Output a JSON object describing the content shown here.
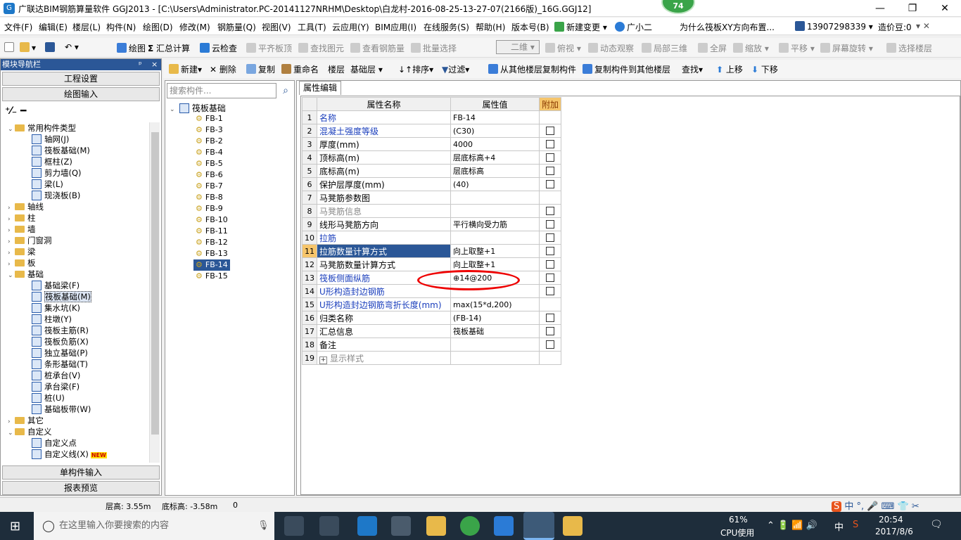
{
  "window": {
    "title": "广联达BIM钢筋算量软件 GGJ2013 - [C:\\Users\\Administrator.PC-20141127NRHM\\Desktop\\白龙村-2016-08-25-13-27-07(2166版)_16G.GGJ12]",
    "badge": "74",
    "minimize": "—",
    "maximize": "❐",
    "close": "✕"
  },
  "menu": [
    "文件(F)",
    "编辑(E)",
    "楼层(L)",
    "构件(N)",
    "绘图(D)",
    "修改(M)",
    "钢筋量(Q)",
    "视图(V)",
    "工具(T)",
    "云应用(Y)",
    "BIM应用(I)",
    "在线服务(S)",
    "帮助(H)",
    "版本号(B)",
    "新建变更",
    "广小二",
    "为什么筏板XY方向布置...",
    "13907298339",
    "造价豆:0"
  ],
  "toolbar1": {
    "draw": "绘图",
    "sum": "汇总计算",
    "cloud": "云检查",
    "flat_top": "平齐板顶",
    "find_elem": "查找图元",
    "view_rebar": "查看钢筋量",
    "batch_select": "批量选择",
    "view_mode": "二维",
    "top_view": "俯视",
    "dynamic": "动态观察",
    "local3d": "局部三维",
    "fullscreen": "全屏",
    "zoom": "缩放",
    "pan": "平移",
    "rotate": "屏幕旋转",
    "select_floor": "选择楼层"
  },
  "nav": {
    "header": "模块导航栏",
    "pin": "ᵖ",
    "close": "×",
    "project_settings": "工程设置",
    "drawing_input": "绘图输入",
    "single_input": "单构件输入",
    "report": "报表预览",
    "tree": [
      {
        "level": 0,
        "type": "folder",
        "label": "常用构件类型",
        "exp": "⌄"
      },
      {
        "level": 1,
        "type": "comp",
        "label": "轴网(J)"
      },
      {
        "level": 1,
        "type": "comp",
        "label": "筏板基础(M)"
      },
      {
        "level": 1,
        "type": "comp",
        "label": "框柱(Z)"
      },
      {
        "level": 1,
        "type": "comp",
        "label": "剪力墙(Q)"
      },
      {
        "level": 1,
        "type": "comp",
        "label": "梁(L)"
      },
      {
        "level": 1,
        "type": "comp",
        "label": "现浇板(B)"
      },
      {
        "level": 0,
        "type": "folder",
        "label": "轴线",
        "exp": "›"
      },
      {
        "level": 0,
        "type": "folder",
        "label": "柱",
        "exp": "›"
      },
      {
        "level": 0,
        "type": "folder",
        "label": "墙",
        "exp": "›"
      },
      {
        "level": 0,
        "type": "folder",
        "label": "门窗洞",
        "exp": "›"
      },
      {
        "level": 0,
        "type": "folder",
        "label": "梁",
        "exp": "›"
      },
      {
        "level": 0,
        "type": "folder",
        "label": "板",
        "exp": "›"
      },
      {
        "level": 0,
        "type": "folder",
        "label": "基础",
        "exp": "⌄"
      },
      {
        "level": 1,
        "type": "comp",
        "label": "基础梁(F)"
      },
      {
        "level": 1,
        "type": "comp",
        "label": "筏板基础(M)",
        "sel": true
      },
      {
        "level": 1,
        "type": "comp",
        "label": "集水坑(K)"
      },
      {
        "level": 1,
        "type": "comp",
        "label": "柱墩(Y)"
      },
      {
        "level": 1,
        "type": "comp",
        "label": "筏板主筋(R)"
      },
      {
        "level": 1,
        "type": "comp",
        "label": "筏板负筋(X)"
      },
      {
        "level": 1,
        "type": "comp",
        "label": "独立基础(P)"
      },
      {
        "level": 1,
        "type": "comp",
        "label": "条形基础(T)"
      },
      {
        "level": 1,
        "type": "comp",
        "label": "桩承台(V)"
      },
      {
        "level": 1,
        "type": "comp",
        "label": "承台梁(F)"
      },
      {
        "level": 1,
        "type": "comp",
        "label": "桩(U)"
      },
      {
        "level": 1,
        "type": "comp",
        "label": "基础板带(W)"
      },
      {
        "level": 0,
        "type": "folder",
        "label": "其它",
        "exp": "›"
      },
      {
        "level": 0,
        "type": "folder",
        "label": "自定义",
        "exp": "⌄"
      },
      {
        "level": 1,
        "type": "comp",
        "label": "自定义点"
      },
      {
        "level": 1,
        "type": "comp",
        "label": "自定义线(X)",
        "new": "NEW"
      }
    ]
  },
  "toolbar2": {
    "new": "新建",
    "delete": "删除",
    "copy": "复制",
    "rename": "重命名",
    "floor_label": "楼层",
    "floor_value": "基础层",
    "sort": "排序",
    "filter": "过滤",
    "copy_from": "从其他楼层复制构件",
    "copy_to": "复制构件到其他楼层",
    "find": "查找",
    "up": "上移",
    "down": "下移"
  },
  "list": {
    "search_placeholder": "搜索构件...",
    "root": "筏板基础",
    "items": [
      "FB-1",
      "FB-3",
      "FB-2",
      "FB-4",
      "FB-5",
      "FB-6",
      "FB-7",
      "FB-8",
      "FB-9",
      "FB-10",
      "FB-11",
      "FB-12",
      "FB-13",
      "FB-14",
      "FB-15"
    ],
    "selected": "FB-14"
  },
  "props": {
    "tab": "属性编辑",
    "headers": {
      "name": "属性名称",
      "value": "属性值",
      "extra": "附加"
    },
    "rows": [
      {
        "n": "1",
        "name": "名称",
        "value": "FB-14",
        "color": "blue",
        "chk": false
      },
      {
        "n": "2",
        "name": "混凝土强度等级",
        "value": "(C30)",
        "color": "blue",
        "chk": true
      },
      {
        "n": "3",
        "name": "厚度(mm)",
        "value": "4000",
        "color": "",
        "chk": true
      },
      {
        "n": "4",
        "name": "顶标高(m)",
        "value": "层底标高+4",
        "color": "",
        "chk": true
      },
      {
        "n": "5",
        "name": "底标高(m)",
        "value": "层底标高",
        "color": "",
        "chk": true
      },
      {
        "n": "6",
        "name": "保护层厚度(mm)",
        "value": "(40)",
        "color": "",
        "chk": true
      },
      {
        "n": "7",
        "name": "马凳筋参数图",
        "value": "",
        "color": "",
        "chk": false
      },
      {
        "n": "8",
        "name": "马凳筋信息",
        "value": "",
        "color": "gray",
        "chk": true
      },
      {
        "n": "9",
        "name": "线形马凳筋方向",
        "value": "平行横向受力筋",
        "color": "",
        "chk": true
      },
      {
        "n": "10",
        "name": "拉筋",
        "value": "",
        "color": "blue",
        "chk": true
      },
      {
        "n": "11",
        "name": "拉筋数量计算方式",
        "value": "向上取整+1",
        "color": "",
        "chk": true,
        "sel": true
      },
      {
        "n": "12",
        "name": "马凳筋数量计算方式",
        "value": "向上取整+1",
        "color": "",
        "chk": true
      },
      {
        "n": "13",
        "name": "筏板侧面纵筋",
        "value": "⊕14@200",
        "color": "blue",
        "chk": true
      },
      {
        "n": "14",
        "name": "U形构造封边钢筋",
        "value": "",
        "color": "blue",
        "chk": true
      },
      {
        "n": "15",
        "name": "U形构造封边钢筋弯折长度(mm)",
        "value": "max(15*d,200)",
        "color": "blue",
        "chk": false
      },
      {
        "n": "16",
        "name": "归类名称",
        "value": "(FB-14)",
        "color": "",
        "chk": true
      },
      {
        "n": "17",
        "name": "汇总信息",
        "value": "筏板基础",
        "color": "",
        "chk": true
      },
      {
        "n": "18",
        "name": "备注",
        "value": "",
        "color": "",
        "chk": true
      },
      {
        "n": "19",
        "name": "显示样式",
        "value": "",
        "color": "gray",
        "chk": false,
        "plus": "+"
      }
    ]
  },
  "status": {
    "floor_height": "层高: 3.55m",
    "bottom_elev": "底标高: -3.58m",
    "zero": "0"
  },
  "taskbar": {
    "search": "在这里输入你要搜索的内容",
    "cpu_pct": "61%",
    "cpu_label": "CPU使用",
    "ime": "中",
    "time": "20:54",
    "date": "2017/8/6"
  },
  "colors": {
    "selection": "#2b5797",
    "highlight_ellipse": "#e00000",
    "taskbar": "#1e2d3b"
  }
}
